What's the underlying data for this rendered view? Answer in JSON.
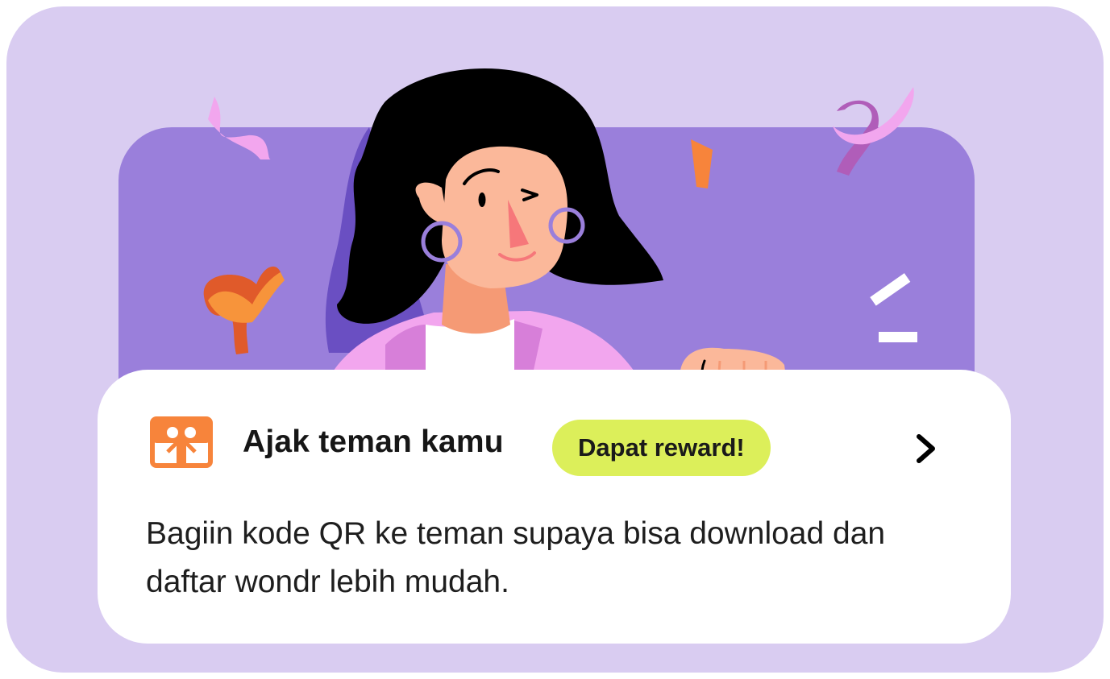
{
  "card": {
    "title": "Ajak teman kamu",
    "badge": "Dapat reward!",
    "description": "Bagiin kode QR ke teman supaya bisa download dan daftar wondr lebih mudah."
  },
  "icons": {
    "gift": "gift-icon",
    "chevron": "chevron-right-icon"
  },
  "colors": {
    "frame_bg": "#d9ccf1",
    "banner_bg": "#9a7fdb",
    "card_bg": "#ffffff",
    "badge_bg": "#dcef5a",
    "gift_icon": "#f7843b",
    "text": "#161616"
  }
}
